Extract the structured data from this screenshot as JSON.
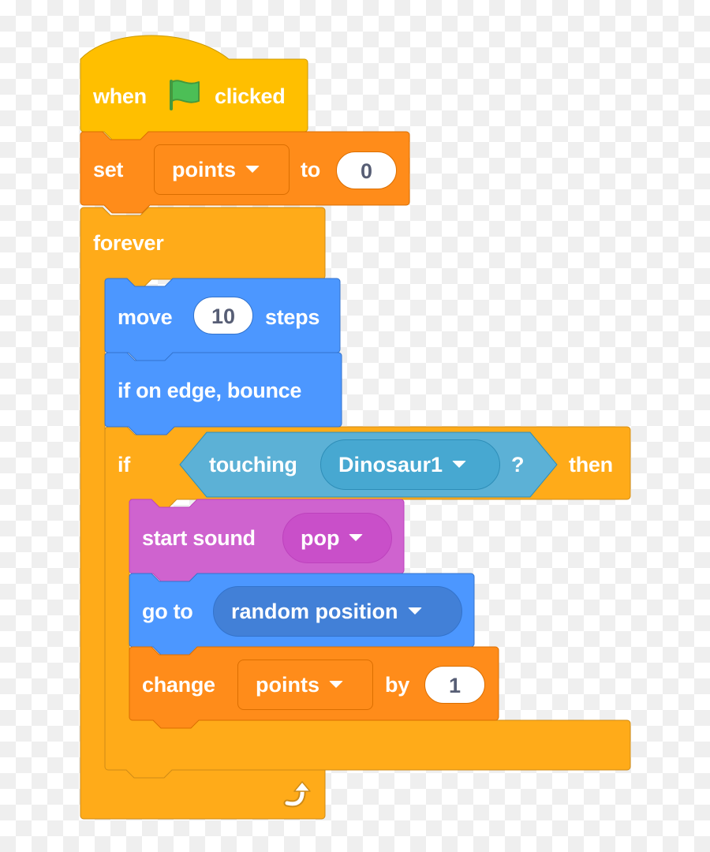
{
  "colors": {
    "events": "#ffbf00",
    "variables": "#ff8c1a",
    "control": "#ffab19",
    "motion": "#4c97ff",
    "sensing": "#5cb1d6",
    "sound": "#cf63cf",
    "input_text": "#575e75",
    "flag": "#4cbf56"
  },
  "script": {
    "hat": {
      "when": "when",
      "flag_icon": "green-flag-icon",
      "clicked": "clicked"
    },
    "set_var": {
      "label": "set",
      "variable": "points",
      "to": "to",
      "value": "0"
    },
    "forever": {
      "label": "forever",
      "loop_icon": "loop-arrow-icon"
    },
    "move": {
      "label": "move",
      "value": "10",
      "suffix": "steps"
    },
    "bounce": {
      "label": "if on edge, bounce"
    },
    "if_block": {
      "label": "if",
      "condition": {
        "label": "touching",
        "target": "Dinosaur1",
        "suffix": "?"
      },
      "then": "then"
    },
    "start_sound": {
      "label": "start sound",
      "sound": "pop"
    },
    "go_to": {
      "label": "go to",
      "target": "random position"
    },
    "change_var": {
      "label": "change",
      "variable": "points",
      "by": "by",
      "value": "1"
    }
  }
}
